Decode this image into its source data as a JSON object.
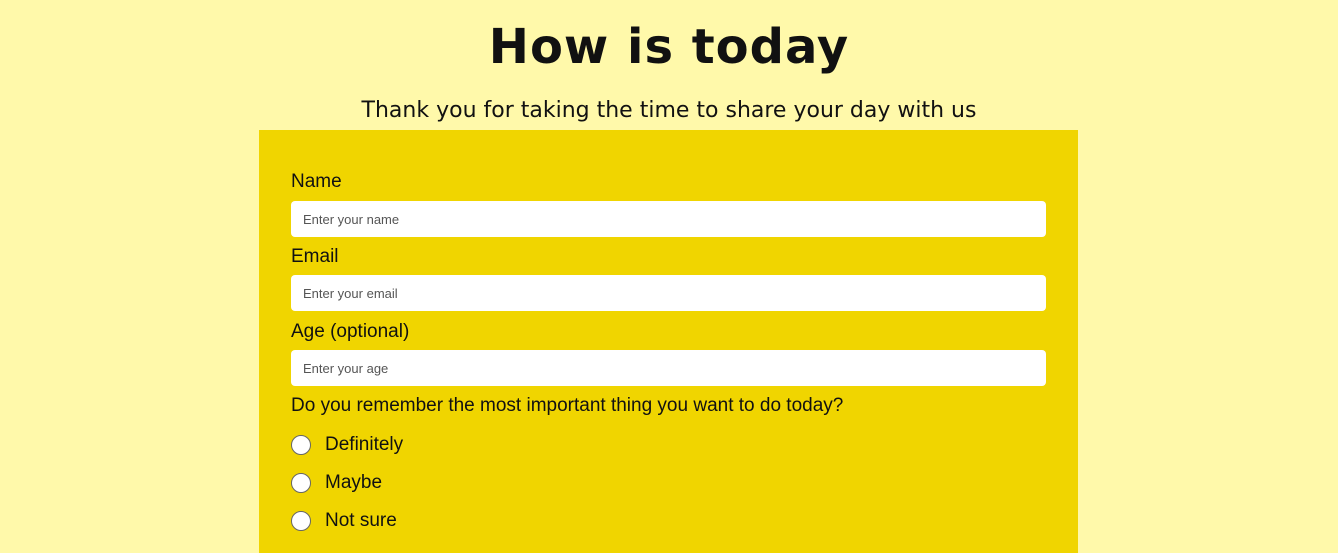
{
  "header": {
    "title": "How is today",
    "subtitle": "Thank you for taking the time to share your day with us"
  },
  "form": {
    "name": {
      "label": "Name",
      "placeholder": "Enter your name",
      "value": ""
    },
    "email": {
      "label": "Email",
      "placeholder": "Enter your email",
      "value": ""
    },
    "age": {
      "label": "Age (optional)",
      "placeholder": "Enter your age",
      "value": ""
    },
    "question": {
      "label": "Do you remember the most important thing you want to do today?",
      "options": [
        "Definitely",
        "Maybe",
        "Not sure"
      ]
    }
  },
  "colors": {
    "page_background": "#fff9aa",
    "card_background": "#f0d500",
    "input_background": "#ffffff"
  }
}
